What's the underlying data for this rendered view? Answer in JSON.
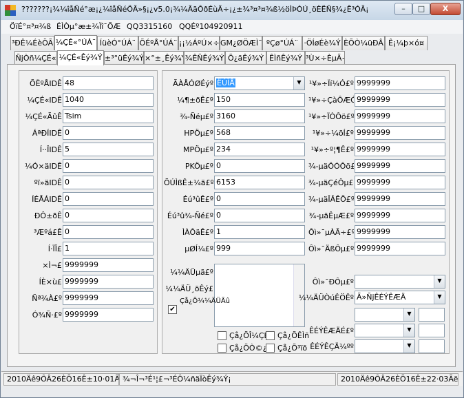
{
  "title": "???????¡¾¼îåÑé°æ¡¿¼îåÑéÖÃ»§¡¿v5.0¡¾¼ÃãÔðÉùÃ÷¡¿±¾³¤³¤¾ß½öÌÞÓÚ¸öÈËÑ§¾¿Ê³ÓÃ¡",
  "window_buttons": {
    "minimize": "–",
    "maximize": "□",
    "close": "X"
  },
  "info": {
    "item1": "ÖïÉ°¤³¤¾ß",
    "item2": "ÉÌÒµ°æ±¾Ïî¯ÕÆ",
    "qq": "QQ3315160",
    "qqe": "QQÉº104920911"
  },
  "tabs_row1": [
    {
      "label": "³ÐÊ¼ÉèÖÃ",
      "selected": false
    },
    {
      "label": "¼ÇÉ«°ÚÁ¨",
      "selected": true
    },
    {
      "label": "ÍüèÓ°ÚÁ¨",
      "selected": false
    },
    {
      "label": "ÕÉºÅ°ÚÁ¨",
      "selected": false
    },
    {
      "label": "¡¡½ÁºÚ×÷",
      "selected": false
    },
    {
      "label": "GM¿ØÖÆÌ¨",
      "selected": false
    },
    {
      "label": "ºÇø°ÚÁ¨",
      "selected": false
    },
    {
      "label": "·ÖÍøÉè¾Ý",
      "selected": false
    },
    {
      "label": "ÈÕÒ¼üÐÂ",
      "selected": false
    },
    {
      "label": "Ê¡¼þ×ó¤",
      "selected": false
    }
  ],
  "tabs_row2": [
    {
      "label": "ÑjÒñ¼ÇÉ«",
      "selected": false
    },
    {
      "label": "¼ÇÉ«Êý¾Ý",
      "selected": true
    },
    {
      "label": "±³°üÊý¾Ý",
      "selected": false
    },
    {
      "label": "×°±¸Êý¾Ý",
      "selected": false
    },
    {
      "label": "¾ÊÑÊý¾Ý",
      "selected": false
    },
    {
      "label": "Õ¿äÊý¾Ý",
      "selected": false
    },
    {
      "label": "ÊÌñÊý¾Ý",
      "selected": false
    },
    {
      "label": "³Ù×÷ÈµÃ÷",
      "selected": false
    }
  ],
  "left_fields": [
    {
      "label": "ÕËºÅIDÊ",
      "value": "48"
    },
    {
      "label": "¼ÇÉ«IDÊ",
      "value": "1040"
    },
    {
      "label": "¼ÇÉ«ÃûÊ",
      "value": "Tsim"
    },
    {
      "label": "ÁªÐÍIDÊ",
      "value": "0"
    },
    {
      "label": "Í··ÎIDÊ",
      "value": "5"
    },
    {
      "label": "¼Ó×äIDÊ",
      "value": "0"
    },
    {
      "label": "ºï»äIDÊ",
      "value": "0"
    },
    {
      "label": "ÍÉÅÁIDÊ",
      "value": "0"
    },
    {
      "label": "ÐÔ±ðÊ",
      "value": "0"
    },
    {
      "label": "³Æºá£Ê",
      "value": "0"
    },
    {
      "label": "Í·ÏÎ£",
      "value": "1"
    },
    {
      "label": "×Ì¬£",
      "value": "9999999"
    },
    {
      "label": "ÍÈ×ù£",
      "value": "9999999"
    },
    {
      "label": "Ñª¾À£º",
      "value": "9999999"
    },
    {
      "label": "Ó¾Ñ·£º",
      "value": "9999999"
    }
  ],
  "mid_fields": {
    "dropdown": {
      "label": "ÃÀÅÓØÉýº",
      "value": "ËÚÌÅ"
    },
    "fields": [
      {
        "label": "¼¶±ðÊ£º",
        "value": "150"
      },
      {
        "label": "¾-Ñéµ£º",
        "value": "3160"
      },
      {
        "label": "HPÖµ£º",
        "value": "568"
      },
      {
        "label": "MPÖµ£º",
        "value": "234"
      },
      {
        "label": "PKÖµ£º",
        "value": "0"
      },
      {
        "label": "ÕÚÌßÊ±¼ä£º",
        "value": "6153"
      },
      {
        "label": "Éú³ûÊ£º",
        "value": "0"
      },
      {
        "label": "Éú³û¾-Ñé£º",
        "value": "0"
      },
      {
        "label": "ÌÀÔäÊ£º",
        "value": "1"
      },
      {
        "label": "µØÍ¼£º",
        "value": "999"
      }
    ],
    "textarea_labels": [
      "¼¼ÄÜµã£º",
      "¼¼ÄÜ¸öÊý£"
    ],
    "checkbox_main": {
      "label": "Çå¿Õ¼¼ÄÜÃû",
      "checked": true
    },
    "checkboxes": [
      {
        "label": "Çå¿ÕÎ¼ÇÉ«",
        "checked": false
      },
      {
        "label": "Çå¿ÕÊÌñ",
        "checked": false
      },
      {
        "label": "Çå¿ÕÒ©¿â",
        "checked": false
      },
      {
        "label": "Çå¿Õ³ïõ",
        "checked": false
      }
    ]
  },
  "right_fields": [
    {
      "label": "¹¥»÷Ïí¼Ó£º",
      "value": "9999999"
    },
    {
      "label": "¹¥»÷ÇàÔÆÓ£º",
      "value": "9999999"
    },
    {
      "label": "¹¥»÷ÏÒÔö£º",
      "value": "9999999"
    },
    {
      "label": "¹¥»÷¼õÍ£º",
      "value": "9999999"
    },
    {
      "label": "¹¥»÷º¦¶Ê£º",
      "value": "9999999"
    },
    {
      "label": "¾-µäÔÓÔö£º",
      "value": "9999999"
    },
    {
      "label": "¾-µäÇéÔµ£º",
      "value": "9999999"
    },
    {
      "label": "¾-µäÎÂÊÕ£º",
      "value": "9999999"
    },
    {
      "label": "¾-µäÊµÆ£º",
      "value": "9999999"
    },
    {
      "label": "Ôì»¯µÀÃ÷£º",
      "value": "9999999"
    },
    {
      "label": "Ôì»¯ÄßÔµ£º",
      "value": "9999999"
    }
  ],
  "right_dropdowns": [
    {
      "label": "Ôì»¯ÐÔµ£º",
      "value": ""
    },
    {
      "label": "¼¼ÄÜÒúÊÖÊº",
      "value": "Ã»ÑjÊÉÝÊÆÄ"
    },
    {
      "label": "",
      "value": ""
    },
    {
      "label": "ÊÉÝÊÆÄÉ£º",
      "value": ""
    },
    {
      "label": "ÊÉÝÊÇÄ¼ºº",
      "value": ""
    }
  ],
  "status": {
    "left": "2010Äê9ÔÂ26ÈÕ16Ê±10·01Ãë",
    "mid": "¾¬Î¬³É¹¦£¬³ÉÔ¼ñäÏòÊý¾Ý¡",
    "right": "2010Äê9ÔÂ26ÈÕ16Ê±22·03Ãë"
  }
}
